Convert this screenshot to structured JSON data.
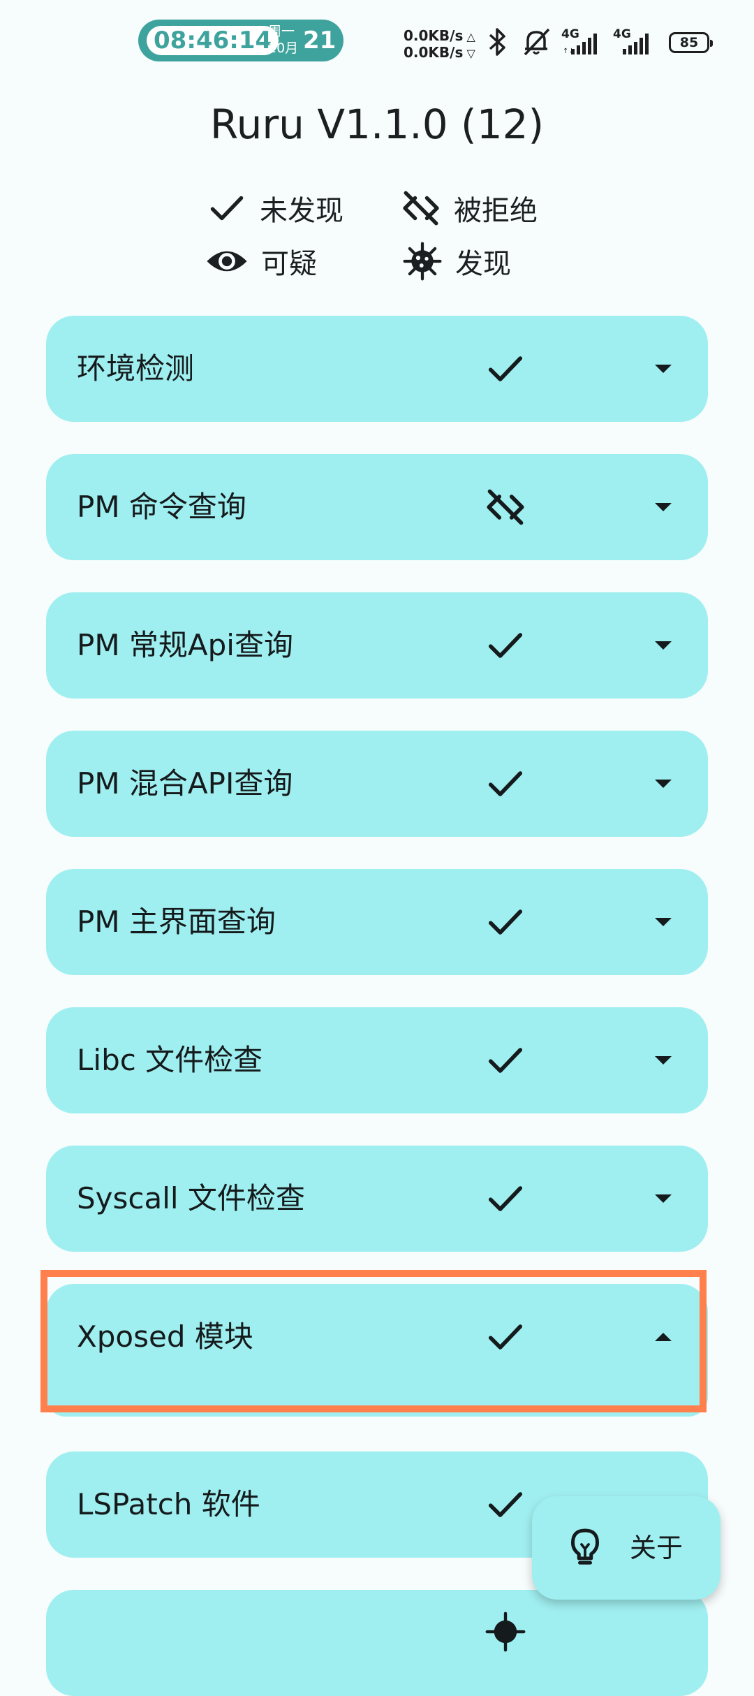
{
  "status_bar": {
    "time": "08:46:14",
    "weekday": "周一",
    "month": "10月",
    "day": "21",
    "upload_speed": "0.0KB/s",
    "download_speed": "0.0KB/s",
    "network_1": "4G",
    "network_2": "4G",
    "battery": "85"
  },
  "app": {
    "title": "Ruru V1.1.0 (12)"
  },
  "legend": {
    "not_found": "未发现",
    "denied": "被拒绝",
    "suspicious": "可疑",
    "found": "发现"
  },
  "checks": [
    {
      "label": "环境检测",
      "status": "not_found",
      "expanded": false
    },
    {
      "label": "PM 命令查询",
      "status": "denied",
      "expanded": false
    },
    {
      "label": "PM 常规Api查询",
      "status": "not_found",
      "expanded": false
    },
    {
      "label": "PM 混合API查询",
      "status": "not_found",
      "expanded": false
    },
    {
      "label": "PM 主界面查询",
      "status": "not_found",
      "expanded": false
    },
    {
      "label": "Libc 文件检查",
      "status": "not_found",
      "expanded": false
    },
    {
      "label": "Syscall 文件检查",
      "status": "not_found",
      "expanded": false
    },
    {
      "label": "Xposed 模块",
      "status": "not_found",
      "expanded": true
    },
    {
      "label": "LSPatch 软件",
      "status": "not_found",
      "expanded": false
    }
  ],
  "fab": {
    "label": "关于",
    "icon": "lightbulb-icon"
  },
  "colors": {
    "card": "#a0eff0",
    "background": "#f7fcfd",
    "highlight": "#ff7f4d",
    "clock": "#3fa39d"
  }
}
